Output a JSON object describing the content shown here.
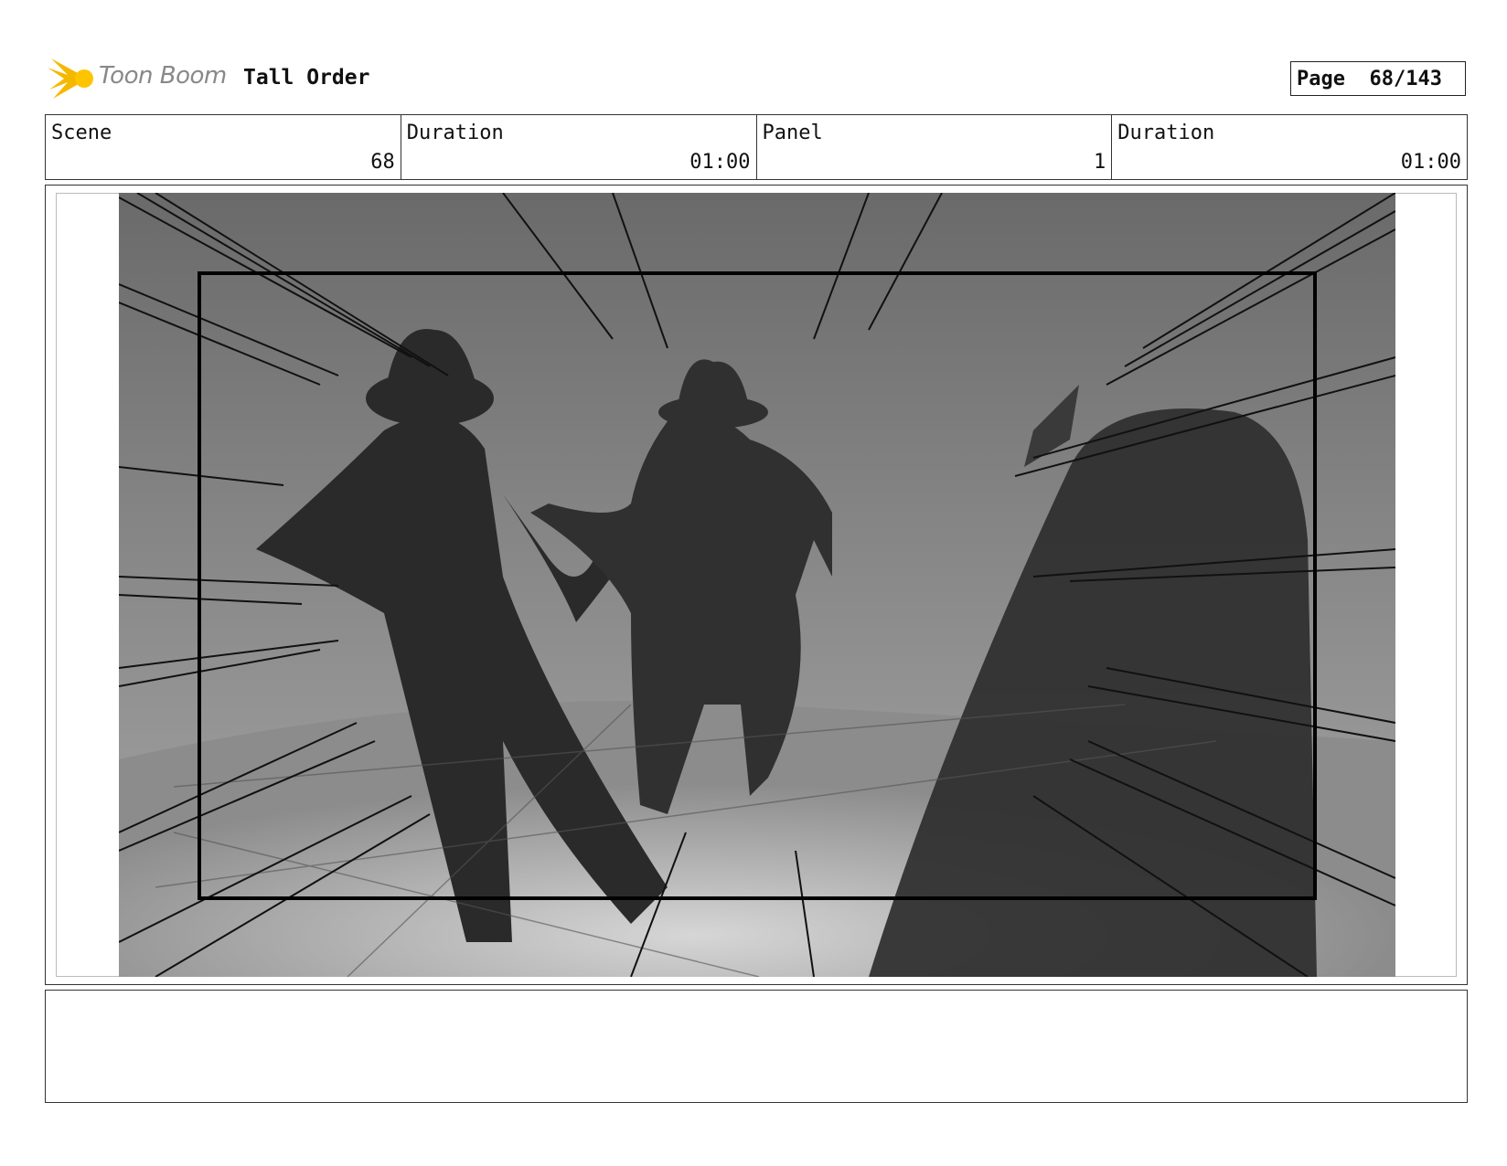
{
  "header": {
    "logo_text": "Toon Boom",
    "project_title": "Tall Order",
    "page_label": "Page",
    "page_value": "68/143"
  },
  "info": {
    "scene_label": "Scene",
    "scene_value": "68",
    "scene_duration_label": "Duration",
    "scene_duration_value": "01:00",
    "panel_label": "Panel",
    "panel_value": "1",
    "panel_duration_label": "Duration",
    "panel_duration_value": "01:00"
  },
  "panel": {
    "image": "storyboard-sketch"
  },
  "notes": {
    "text": ""
  },
  "colors": {
    "logo_accent": "#f5b800",
    "border": "#333333"
  }
}
